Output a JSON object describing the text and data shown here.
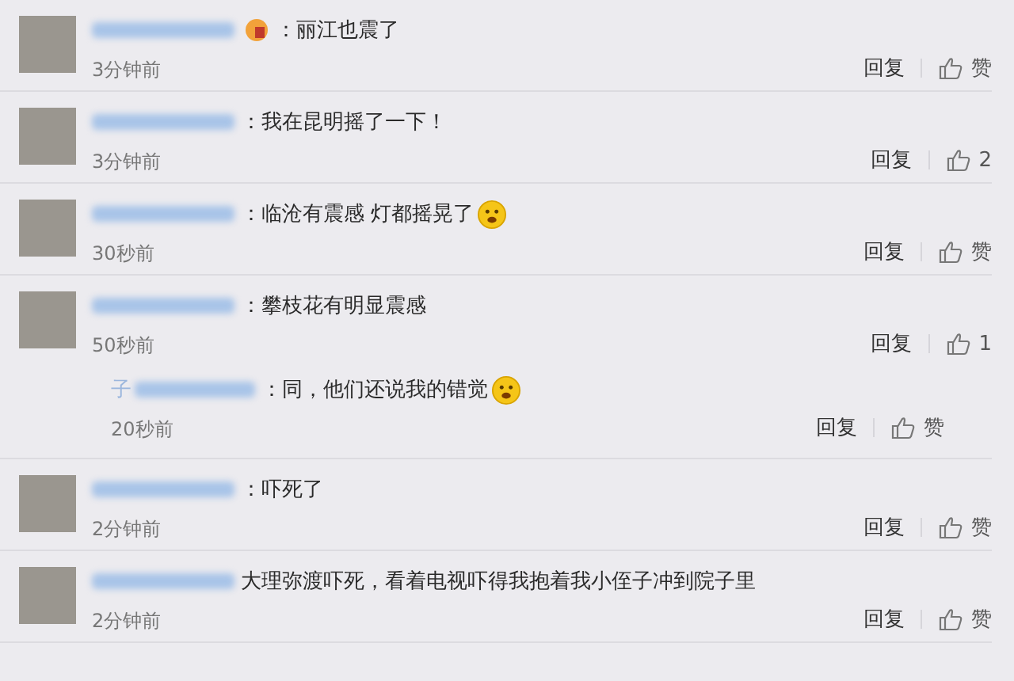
{
  "comments": [
    {
      "name_badge": true,
      "text": "：丽江也震了",
      "emoji": false,
      "time": "3分钟前",
      "reply_label": "回复",
      "like_label": "赞"
    },
    {
      "name_badge": false,
      "text": "：我在昆明摇了一下！",
      "emoji": false,
      "time": "3分钟前",
      "reply_label": "回复",
      "like_label": "2"
    },
    {
      "name_badge": false,
      "text": "：临沧有震感 灯都摇晃了",
      "emoji": true,
      "time": "30秒前",
      "reply_label": "回复",
      "like_label": "赞"
    },
    {
      "name_badge": false,
      "text": "：攀枝花有明显震感",
      "emoji": false,
      "time": "50秒前",
      "reply_label": "回复",
      "like_label": "1",
      "replies": [
        {
          "name_prefix": "子",
          "text": "：同，他们还说我的错觉",
          "emoji": true,
          "time": "20秒前",
          "reply_label": "回复",
          "like_label": "赞"
        }
      ]
    },
    {
      "name_badge": false,
      "text": "：吓死了",
      "emoji": false,
      "time": "2分钟前",
      "reply_label": "回复",
      "like_label": "赞"
    },
    {
      "name_badge": false,
      "text": "大理弥渡吓死，看着电视吓得我抱着我小侄子冲到院子里",
      "emoji": false,
      "time": "2分钟前",
      "reply_label": "回复",
      "like_label": "赞"
    }
  ]
}
